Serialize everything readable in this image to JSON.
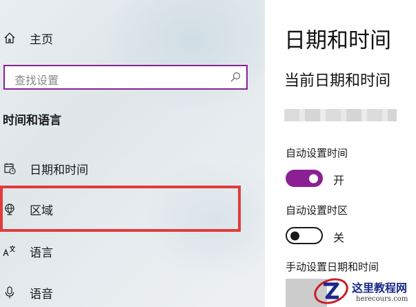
{
  "sidebar": {
    "home_label": "主页",
    "search_placeholder": "查找设置",
    "section_title": "时间和语言",
    "items": [
      {
        "label": "日期和时间",
        "icon": "calendar-clock-icon"
      },
      {
        "label": "区域",
        "icon": "globe-icon"
      },
      {
        "label": "语言",
        "icon": "language-icon"
      },
      {
        "label": "语音",
        "icon": "microphone-icon"
      }
    ]
  },
  "main": {
    "page_title": "日期和时间",
    "current_datetime_heading": "当前日期和时间",
    "auto_time": {
      "label": "自动设置时间",
      "state": "开"
    },
    "auto_timezone": {
      "label": "自动设置时区",
      "state": "关"
    },
    "manual_label": "手动设置日期和时间"
  },
  "watermark": {
    "site": "这里教程网",
    "url": "herecours.com"
  },
  "colors": {
    "accent": "#8b1f93",
    "highlight_border": "#e23b3b"
  }
}
